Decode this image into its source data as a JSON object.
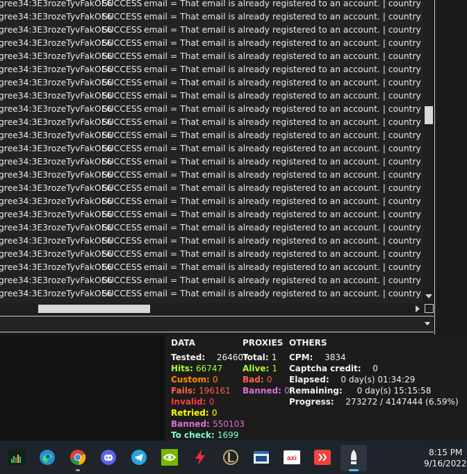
{
  "log": {
    "rows": [
      {
        "combo": "gree34:3E3rozeTyvFakOE6",
        "status": "SUCCESS",
        "message": "email = That email is already registered to an account. | country = CO"
      },
      {
        "combo": "gree34:3E3rozeTyvFakOE6",
        "status": "SUCCESS",
        "message": "email = That email is already registered to an account. | country = US"
      },
      {
        "combo": "gree34:3E3rozeTyvFakOE6",
        "status": "SUCCESS",
        "message": "email = That email is already registered to an account. | country = BG"
      },
      {
        "combo": "gree34:3E3rozeTyvFakOE6",
        "status": "SUCCESS",
        "message": "email = That email is already registered to an account. | country = DO"
      },
      {
        "combo": "gree34:3E3rozeTyvFakOE6",
        "status": "SUCCESS",
        "message": "email = That email is already registered to an account. | country = US"
      },
      {
        "combo": "gree34:3E3rozeTyvFakOE6",
        "status": "SUCCESS",
        "message": "email = That email is already registered to an account. | country = VN"
      },
      {
        "combo": "gree34:3E3rozeTyvFakOE6",
        "status": "SUCCESS",
        "message": "email = That email is already registered to an account. | country = US"
      },
      {
        "combo": "gree34:3E3rozeTyvFakOE6",
        "status": "SUCCESS",
        "message": "email = That email is already registered to an account. | country = ZA"
      },
      {
        "combo": "gree34:3E3rozeTyvFakOE6",
        "status": "SUCCESS",
        "message": "email = That email is already registered to an account. | country = BR"
      },
      {
        "combo": "gree34:3E3rozeTyvFakOE6",
        "status": "SUCCESS",
        "message": "email = That email is already registered to an account. | country = CL"
      },
      {
        "combo": "gree34:3E3rozeTyvFakOE6",
        "status": "SUCCESS",
        "message": "email = That email is already registered to an account. | country = BR"
      },
      {
        "combo": "gree34:3E3rozeTyvFakOE6",
        "status": "SUCCESS",
        "message": "email = That email is already registered to an account. | country = MA"
      },
      {
        "combo": "gree34:3E3rozeTyvFakOE6",
        "status": "SUCCESS",
        "message": "email = That email is already registered to an account. | country = US"
      },
      {
        "combo": "gree34:3E3rozeTyvFakOE6",
        "status": "SUCCESS",
        "message": "email = That email is already registered to an account. | country = CH"
      },
      {
        "combo": "gree34:3E3rozeTyvFakOE6",
        "status": "SUCCESS",
        "message": "email = That email is already registered to an account. | country = TR"
      },
      {
        "combo": "gree34:3E3rozeTyvFakOE6",
        "status": "SUCCESS",
        "message": "email = That email is already registered to an account. | country = ID"
      },
      {
        "combo": "gree34:3E3rozeTyvFakOE6",
        "status": "SUCCESS",
        "message": "email = That email is already registered to an account. | country = DE"
      },
      {
        "combo": "gree34:3E3rozeTyvFakOE6",
        "status": "SUCCESS",
        "message": "email = That email is already registered to an account. | country = TW"
      },
      {
        "combo": "gree34:3E3rozeTyvFakOE6",
        "status": "SUCCESS",
        "message": "email = That email is already registered to an account. | country = BR"
      },
      {
        "combo": "gree34:3E3rozeTyvFakOE6",
        "status": "SUCCESS",
        "message": "email = That email is already registered to an account. | country = BR"
      },
      {
        "combo": "gree34:3E3rozeTyvFakOE6",
        "status": "SUCCESS",
        "message": "email = That email is already registered to an account. | country = VN"
      },
      {
        "combo": "gree34:3E3rozeTyvFakOE6",
        "status": "SUCCESS",
        "message": "email = That email is already registered to an account. | country = TR"
      },
      {
        "combo": "gree34:3E3rozeTyvFakOE6",
        "status": "SUCCESS",
        "message": "email = That email is already registered to an account. | country = US"
      }
    ]
  },
  "stats": {
    "data": {
      "header": "DATA",
      "tested_label": "Tested:",
      "tested_value": "264607",
      "hits_label": "Hits:",
      "hits_value": "66747",
      "custom_label": "Custom:",
      "custom_value": "0",
      "fails_label": "Fails:",
      "fails_value": "196161",
      "invalid_label": "Invalid:",
      "invalid_value": "0",
      "retried_label": "Retried:",
      "retried_value": "0",
      "banned_label": "Banned:",
      "banned_value": "550103",
      "tocheck_label": "To check:",
      "tocheck_value": "1699"
    },
    "proxies": {
      "header": "PROXIES",
      "total_label": "Total:",
      "total_value": "1",
      "alive_label": "Alive:",
      "alive_value": "1",
      "bad_label": "Bad:",
      "bad_value": "0",
      "banned_label": "Banned:",
      "banned_value": "0"
    },
    "others": {
      "header": "OTHERS",
      "cpm_label": "CPM:",
      "cpm_value": "3834",
      "captcha_label": "Captcha credit:",
      "captcha_value": "0",
      "elapsed_label": "Elapsed:",
      "elapsed_value": "0 day(s) 01:34:29",
      "remaining_label": "Remaining:",
      "remaining_value": "0 day(s) 15:15:58",
      "progress_label": "Progress:",
      "progress_value": "273272 / 4147444 (6.59%)"
    }
  },
  "colors": {
    "hits": "#adff2f",
    "custom": "#ff8c00",
    "fails": "#ff6347",
    "invalid": "#ff3c3c",
    "retried": "#ffff00",
    "banned": "#da70d6",
    "tocheck": "#7fffd4",
    "accent": "#4cc2ff"
  },
  "taskbar": {
    "icons": [
      "task-manager-icon",
      "edge-icon",
      "chrome-icon",
      "discord-icon",
      "telegram-icon",
      "nvidia-icon",
      "lightning-app-icon",
      "league-of-legends-icon",
      "window-app-icon",
      "axi-icon",
      "anydesk-icon",
      "openbullet-icon"
    ],
    "time": "8:15 PM",
    "date": "9/16/2022"
  }
}
